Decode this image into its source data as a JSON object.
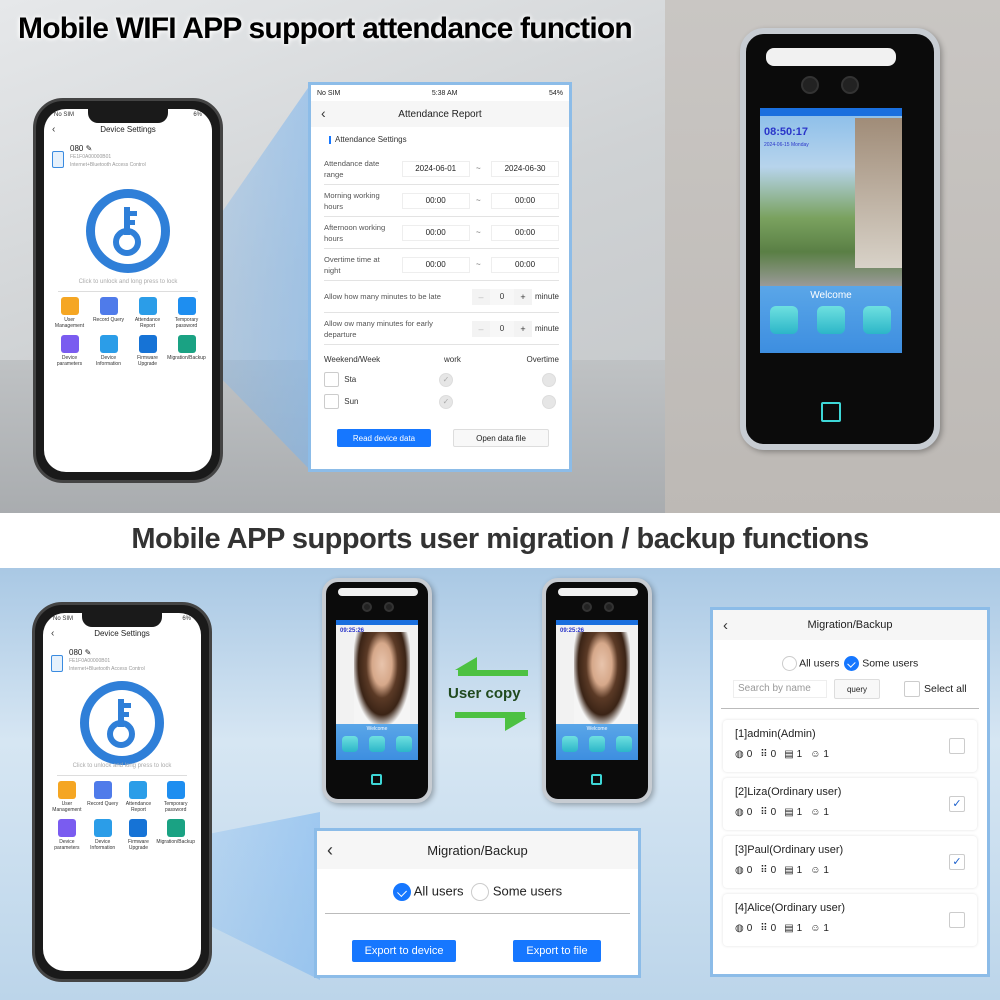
{
  "headings": {
    "top": "Mobile WIFI APP support attendance function",
    "middle": "Mobile APP supports user migration / backup functions"
  },
  "phone_device_settings": {
    "status_left": "No SIM",
    "status_right": "6%",
    "title": "Device Settings",
    "device_name": "080",
    "device_id": "FE1F0A00000B01",
    "device_type": "Internet+Bluetooth Access Control",
    "unlock_hint": "Click to unlock and long press to lock",
    "menu": [
      {
        "label": "User Management",
        "icon": "user-gear-icon",
        "color": "#f5a623"
      },
      {
        "label": "Record Query",
        "icon": "record-clock-icon",
        "color": "#4f7bea"
      },
      {
        "label": "Attendance Report",
        "icon": "calendar-gear-icon",
        "color": "#2b9de8"
      },
      {
        "label": "Temporary password",
        "icon": "lock-icon",
        "color": "#1e8ef0"
      },
      {
        "label": "Device parameters",
        "icon": "gear-icon",
        "color": "#7a5cf0"
      },
      {
        "label": "Device Information",
        "icon": "id-card-icon",
        "color": "#2b9de8"
      },
      {
        "label": "Firmware Upgrade",
        "icon": "upload-icon",
        "color": "#1673d6"
      },
      {
        "label": "Migration/Backup",
        "icon": "share-icon",
        "color": "#1aa283"
      }
    ]
  },
  "attendance_report": {
    "status": {
      "carrier": "No SIM",
      "time": "5:38 AM",
      "battery": "54%"
    },
    "title": "Attendance Report",
    "section": "Attendance Settings",
    "rows": [
      {
        "label": "Attendance date range",
        "from": "2024-06-01",
        "to": "2024-06-30"
      },
      {
        "label": "Morning working hours",
        "from": "00:00",
        "to": "00:00"
      },
      {
        "label": "Afternoon working hours",
        "from": "00:00",
        "to": "00:00"
      },
      {
        "label": "Overtime time at night",
        "from": "00:00",
        "to": "00:00"
      }
    ],
    "range_separator": "~",
    "steppers": [
      {
        "label": "Allow how many minutes to be late",
        "value": "0",
        "unit": "minute"
      },
      {
        "label": "Allow ow many minutes for early departure",
        "value": "0",
        "unit": "minute"
      }
    ],
    "weekend_headers": {
      "day": "Weekend/Week",
      "work": "work",
      "overtime": "Overtime"
    },
    "weekend_days": [
      {
        "day": "Sta",
        "checked": false,
        "work": true,
        "overtime": false
      },
      {
        "day": "Sun",
        "checked": false,
        "work": true,
        "overtime": false
      }
    ],
    "buttons": {
      "read": "Read device data",
      "open": "Open data file"
    }
  },
  "terminal_top": {
    "time": "08:50:17",
    "date": "2024-06-15 Monday",
    "welcome": "Welcome"
  },
  "terminals_bottom": {
    "time": "09:25:26",
    "welcome": "Welcome",
    "copy_label": "User copy"
  },
  "migration_small": {
    "title": "Migration/Backup",
    "options": [
      {
        "label": "All users",
        "selected": true
      },
      {
        "label": "Some users",
        "selected": false
      }
    ],
    "buttons": {
      "device": "Export to device",
      "file": "Export to file"
    }
  },
  "migration_list": {
    "title": "Migration/Backup",
    "options": [
      {
        "label": "All users",
        "selected": false
      },
      {
        "label": "Some users",
        "selected": true
      }
    ],
    "search_placeholder": "Search by name",
    "query_label": "query",
    "select_all_label": "Select all",
    "users": [
      {
        "name": "[1]admin(Admin)",
        "fingerprint": "0",
        "password": "0",
        "card": "1",
        "face": "1",
        "checked": false
      },
      {
        "name": "[2]Liza(Ordinary user)",
        "fingerprint": "0",
        "password": "0",
        "card": "1",
        "face": "1",
        "checked": true
      },
      {
        "name": "[3]Paul(Ordinary user)",
        "fingerprint": "0",
        "password": "0",
        "card": "1",
        "face": "1",
        "checked": true
      },
      {
        "name": "[4]Alice(Ordinary user)",
        "fingerprint": "0",
        "password": "0",
        "card": "1",
        "face": "1",
        "checked": false
      }
    ]
  }
}
